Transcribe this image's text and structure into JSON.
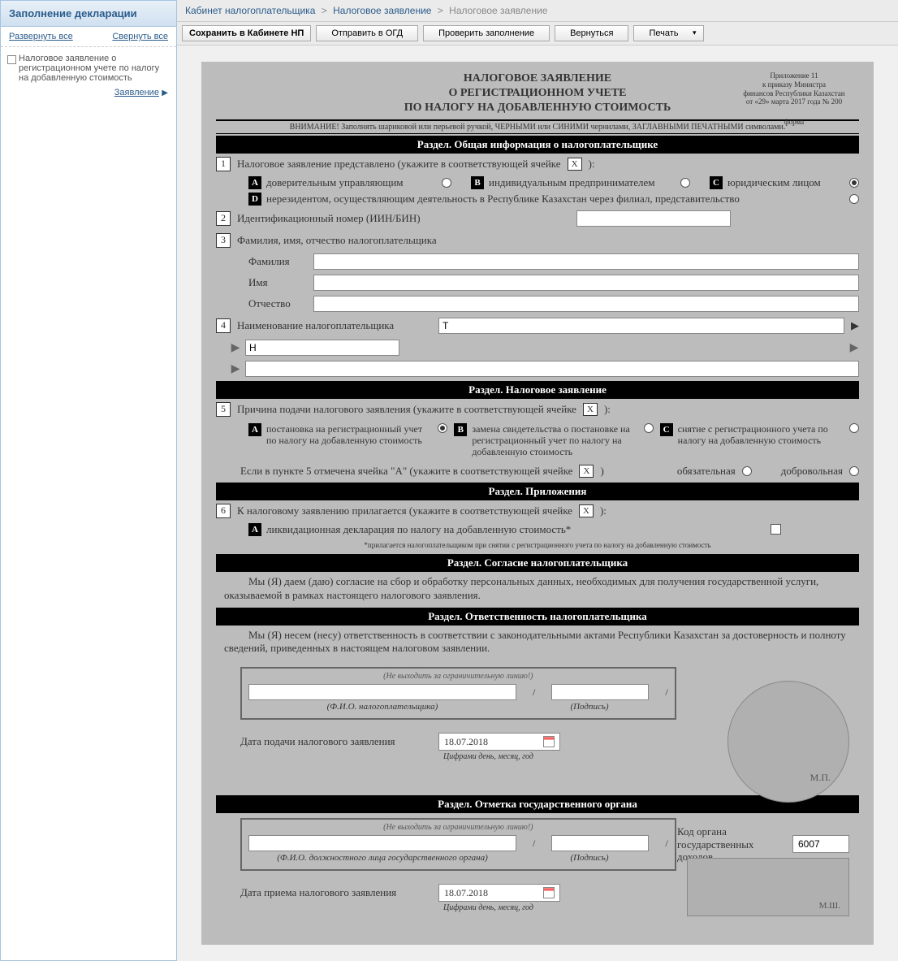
{
  "sidebar": {
    "title": "Заполнение декларации",
    "expand_all": "Развернуть все",
    "collapse_all": "Свернуть все",
    "item": "Налоговое заявление о регистрационном учете по налогу на добавленную стоимость",
    "sub": "Заявление"
  },
  "breadcrumb": {
    "a": "Кабинет налогоплательщика",
    "b": "Налоговое заявление",
    "c": "Налоговое заявление"
  },
  "toolbar": {
    "save": "Сохранить в Кабинете НП",
    "send": "Отправить в ОГД",
    "check": "Проверить заполнение",
    "back": "Вернуться",
    "print": "Печать"
  },
  "doc": {
    "title1": "НАЛОГОВОЕ ЗАЯВЛЕНИЕ",
    "title2": "О РЕГИСТРАЦИОННОМ УЧЕТЕ",
    "title3": "ПО НАЛОГУ НА ДОБАВЛЕННУЮ СТОИМОСТЬ",
    "annex1": "Приложение 11",
    "annex2": "к приказу Министра",
    "annex3": "финансов Республики Казахстан",
    "annex4": "от «29» марта 2017 года № 200",
    "annex5": "форма",
    "warning": "ВНИМАНИЕ! Заполнять шариковой или перьевой ручкой, ЧЕРНЫМИ или СИНИМИ чернилами, ЗАГЛАВНЫМИ ПЕЧАТНЫМИ символами.",
    "section1": "Раздел. Общая информация о налогоплательщике",
    "q1": "Налоговое заявление представлено (укажите в соответствующей ячейке",
    "x": "X",
    "paren": "):",
    "opt_a": "доверительным управляющим",
    "opt_b": "индивидуальным предпринимателем",
    "opt_c": "юридическим лицом",
    "opt_d": "нерезидентом, осуществляющим деятельность в Республике Казахстан через филиал, представительство",
    "q2": "Идентификационный номер (ИИН/БИН)",
    "iin": "",
    "q3": "Фамилия, имя, отчество налогоплательщика",
    "lbl_fam": "Фамилия",
    "lbl_name": "Имя",
    "lbl_otc": "Отчество",
    "q4": "Наименование налогоплательщика",
    "name_val": "Т",
    "name_val2": "Н",
    "section2": "Раздел. Налоговое заявление",
    "q5": "Причина подачи налогового заявления (укажите в соответствующей ячейке",
    "opt5a": "постановка на регистрационный учет по налогу на добавленную стоимость",
    "opt5b": "замена свидетельства о постановке на регистрационный учет по налогу на добавленную стоимость",
    "opt5c": "снятие с регистрационного учета по налогу на добавленную стоимость",
    "q5note": "Если в пункте 5 отмечена ячейка   \"А\"   (укажите в соответствующей ячейке",
    "mandatory": "обязательная",
    "voluntary": "добровольная",
    "section3": "Раздел. Приложения",
    "q6": "К налоговому заявлению прилагается  (укажите в соответствующей ячейке",
    "opt6a": "ликвидационная декларация по налогу на добавленную стоимость*",
    "footnote6": "*прилагается налогоплательщиком при снятии с регистрационного учета по налогу на добавленную стоимость",
    "section4": "Раздел. Согласие налогоплательщика",
    "consent": "Мы (Я) даем (даю) согласие на сбор и обработку персональных данных, необходимых для получения государственной услуги, оказываемой в рамках настоящего налогового заявления.",
    "section5": "Раздел. Ответственность налогоплательщика",
    "resp": "Мы (Я) несем (несу) ответственность в соответствии с законодательными актами Республики Казахстан за достоверность и полноту сведений, приведенных в настоящем налоговом заявлении.",
    "sign_hint": "(Не выходить за ограничительную линию!)",
    "fio_lbl": "(Ф.И.О. налогоплательщика)",
    "sig_lbl": "(Подпись)",
    "stamp_mp": "М.П.",
    "date_submit_lbl": "Дата подачи налогового заявления",
    "date_submit": "18.07.2018",
    "date_hint": "Цифрами день, месяц, год",
    "section6": "Раздел. Отметка государственного органа",
    "fio_gov_lbl": "(Ф.И.О. должностного лица государственного органа)",
    "date_accept_lbl": "Дата приема налогового заявления",
    "date_accept": "18.07.2018",
    "gov_code_lbl": "Код органа государственных доходов",
    "gov_code": "6007",
    "stamp_ms": "М.Ш."
  }
}
